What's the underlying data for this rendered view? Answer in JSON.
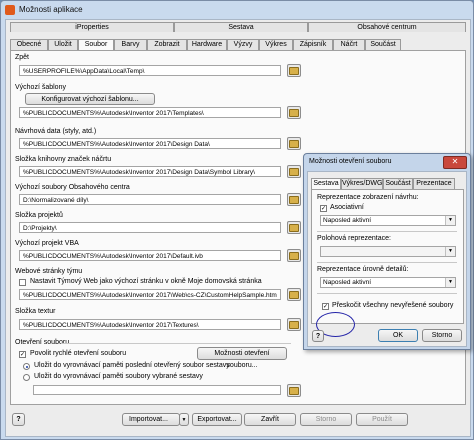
{
  "window": {
    "title": "Možnosti aplikace"
  },
  "groups": [
    "iProperties",
    "Sestava",
    "Obsahové centrum"
  ],
  "tabs": [
    "Obecné",
    "Uložit",
    "Soubor",
    "Barvy",
    "Zobrazit",
    "Hardware",
    "Výzvy",
    "Výkres",
    "Zápisník",
    "Náčrt",
    "Součást"
  ],
  "active_tab": "Soubor",
  "sections": [
    {
      "label": "Zpět",
      "value": "%USERPROFILE%\\AppData\\Local\\Temp\\"
    },
    {
      "label": "Výchozí šablony",
      "button": "Konfigurovat výchozí šablonu...",
      "value": "%PUBLICDOCUMENTS%\\Autodesk\\Inventor 2017\\Templates\\"
    },
    {
      "label": "Návrhová data (styly, atd.)",
      "value": "%PUBLICDOCUMENTS%\\Autodesk\\Inventor 2017\\Design Data\\"
    },
    {
      "label": "Složka knihovny značek náčrtu",
      "value": "%PUBLICDOCUMENTS%\\Autodesk\\Inventor 2017\\Design Data\\Symbol Library\\"
    },
    {
      "label": "Výchozí soubory Obsahového centra",
      "value": "D:\\Normalizované díly\\"
    },
    {
      "label": "Složka projektů",
      "value": "D:\\Projekty\\"
    },
    {
      "label": "Výchozí projekt VBA",
      "value": "%PUBLICDOCUMENTS%\\Autodesk\\Inventor 2017\\Default.ivb"
    }
  ],
  "web": {
    "label": "Webové stránky týmu",
    "checkbox": "Nastavit Týmový Web jako výchozí stránku v okně Moje domovská stránka",
    "value": "%PUBLICDOCUMENTS%\\Autodesk\\Inventor 2017\\Web\\cs-CZ\\CustomHelpSample.htm"
  },
  "textures": {
    "label": "Složka textur",
    "value": "%PUBLICDOCUMENTS%\\Autodesk\\Inventor 2017\\Textures\\"
  },
  "quickopen": {
    "label": "Otevření souboru",
    "checkbox": "Povolit rychlé otevření souboru",
    "button": "Možnosti otevření souboru...",
    "radio1": "Uložit do vyrovnávací paměti poslední otevřený soubor sestavy",
    "radio2": "Uložit do vyrovnávací paměti soubory vybrané sestavy"
  },
  "bottom": {
    "import": "Importovat...",
    "export": "Exportovat...",
    "close": "Zavřít",
    "cancel": "Storno",
    "apply": "Použít"
  },
  "dialog": {
    "title": "Možnosti otevření souboru",
    "close_glyph": "✕",
    "tabs": [
      "Sestava",
      "Výkres/DWG",
      "Součást",
      "Prezentace"
    ],
    "rep_label": "Reprezentace zobrazení návrhu:",
    "assoc": "Asociativní",
    "rep_value": "Naposled aktivní",
    "pos_label": "Polohová reprezentace:",
    "pos_value": "",
    "lod_label": "Reprezentace úrovně detailů:",
    "lod_value": "Naposled aktivní",
    "skip": "Přeskočit všechny nevyřešené soubory",
    "ok": "OK",
    "cancel": "Storno"
  }
}
